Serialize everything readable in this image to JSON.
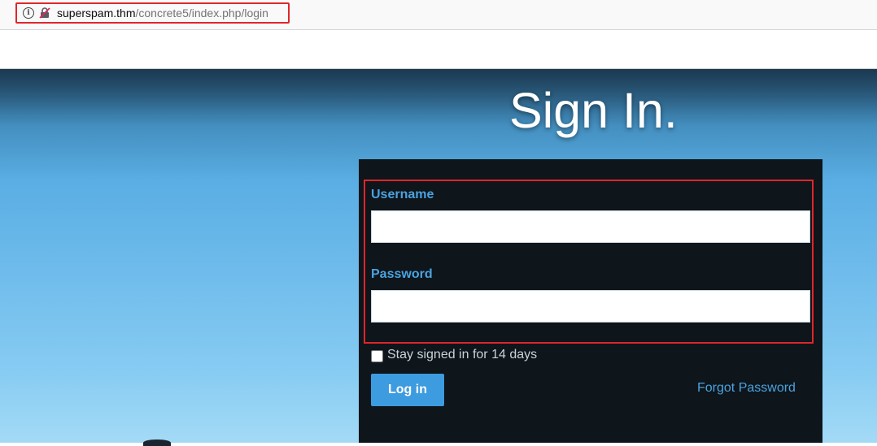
{
  "browser": {
    "url_domain": "superspam.thm",
    "url_path": "/concrete5/index.php/login",
    "info_icon": "i"
  },
  "page": {
    "title": "Sign In."
  },
  "form": {
    "username_label": "Username",
    "username_value": "",
    "password_label": "Password",
    "password_value": "",
    "remember_label": "Stay signed in for 14 days",
    "remember_checked": false,
    "login_button": "Log in",
    "forgot_link": "Forgot Password"
  },
  "colors": {
    "accent": "#3d9be0",
    "label": "#4aa3df",
    "panel": "#0e151b",
    "highlight": "#e0262a"
  },
  "icons": {
    "info": "info-icon",
    "insecure_lock": "insecure-lock-icon"
  }
}
